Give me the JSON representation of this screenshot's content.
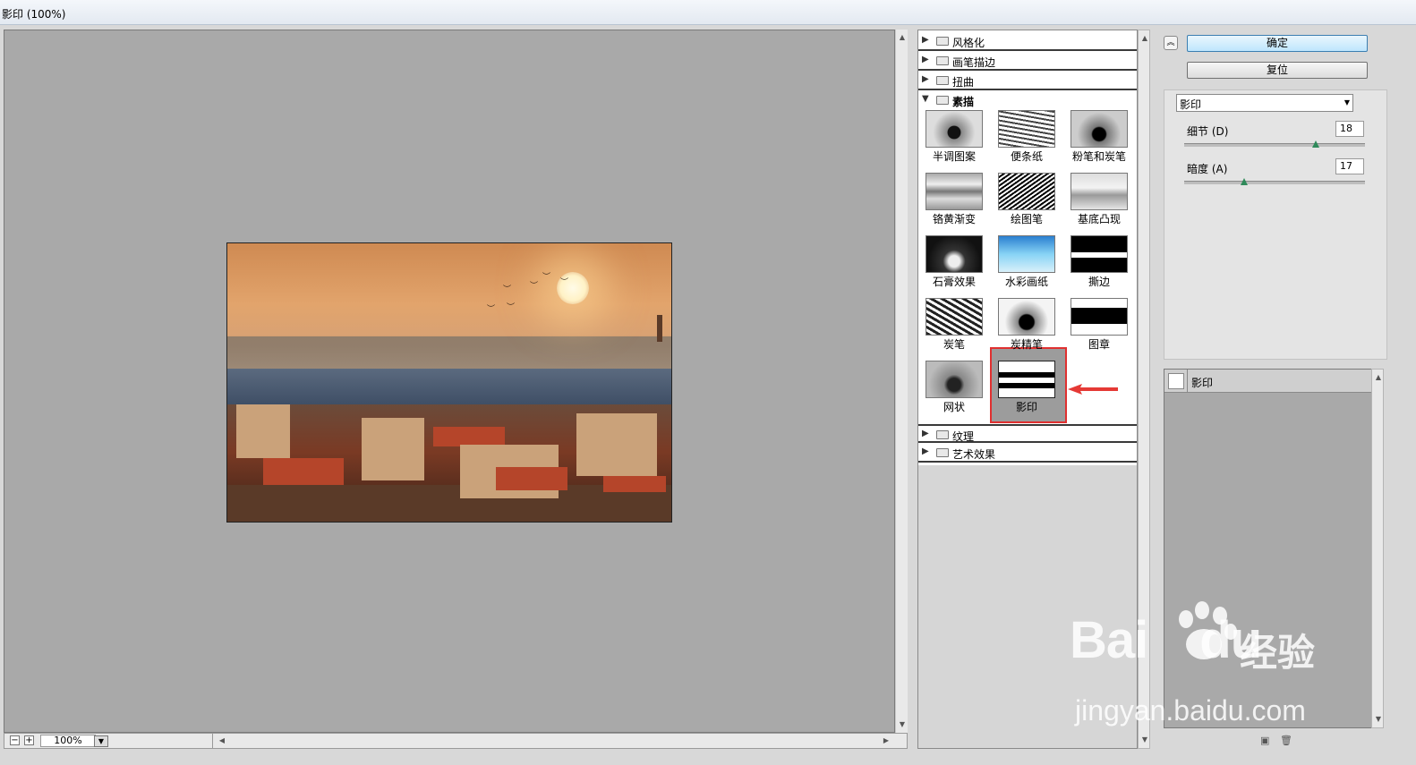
{
  "window": {
    "title": "影印 (100%)"
  },
  "preview": {
    "zoom": "100%"
  },
  "gallery": {
    "categories_top": [
      {
        "label": "风格化"
      },
      {
        "label": "画笔描边"
      },
      {
        "label": "扭曲"
      },
      {
        "label": "素描"
      }
    ],
    "thumbs": [
      {
        "label": "半调图案"
      },
      {
        "label": "便条纸"
      },
      {
        "label": "粉笔和炭笔"
      },
      {
        "label": "铬黄渐变"
      },
      {
        "label": "绘图笔"
      },
      {
        "label": "基底凸现"
      },
      {
        "label": "石膏效果"
      },
      {
        "label": "水彩画纸"
      },
      {
        "label": "撕边"
      },
      {
        "label": "炭笔"
      },
      {
        "label": "炭精笔"
      },
      {
        "label": "图章"
      },
      {
        "label": "网状"
      },
      {
        "label": "影印"
      }
    ],
    "categories_bottom": [
      {
        "label": "纹理"
      },
      {
        "label": "艺术效果"
      }
    ]
  },
  "buttons": {
    "ok": "确定",
    "reset": "复位"
  },
  "filter_select": {
    "value": "影印"
  },
  "params": [
    {
      "label": "细节 (D)",
      "value": "18",
      "fraction": 0.73
    },
    {
      "label": "暗度 (A)",
      "value": "17",
      "fraction": 0.33
    }
  ],
  "layers": [
    {
      "name": "影印"
    }
  ],
  "watermark": {
    "brand": "Bai",
    "brand2": "du",
    "cn": "经验",
    "url": "jingyan.baidu.com"
  }
}
